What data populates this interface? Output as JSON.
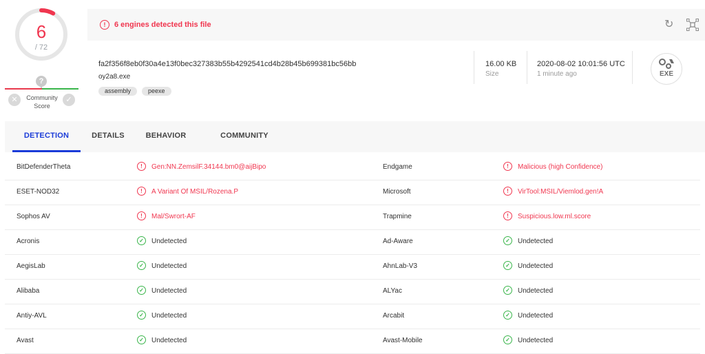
{
  "score": {
    "detected": "6",
    "total": "/ 72"
  },
  "community": {
    "label_line1": "Community",
    "label_line2": "Score",
    "question": "?"
  },
  "banner": {
    "text": "6 engines detected this file"
  },
  "file": {
    "hash": "fa2f356f8eb0f30a4e13f0bec327383b55b4292541cd4b28b45b699381bc56bb",
    "name": "oy2a8.exe",
    "tags": [
      "assembly",
      "peexe"
    ],
    "size_value": "16.00 KB",
    "size_label": "Size",
    "date_value": "2020-08-02 10:01:56 UTC",
    "date_label": "1 minute ago",
    "type_icon_label": "EXE"
  },
  "tabs": [
    {
      "label": "DETECTION",
      "active": true
    },
    {
      "label": "DETAILS",
      "active": false
    },
    {
      "label": "BEHAVIOR",
      "active": false
    },
    {
      "label": "COMMUNITY",
      "active": false
    }
  ],
  "colors": {
    "malicious": "#f0364f",
    "clean": "#39b54a",
    "accent": "#1a3bd8"
  },
  "detections": [
    {
      "left_engine": "BitDefenderTheta",
      "left_result": "Gen:NN.ZemsilF.34144.bm0@aijBipo",
      "left_status": "malicious",
      "right_engine": "Endgame",
      "right_result": "Malicious (high Confidence)",
      "right_status": "malicious"
    },
    {
      "left_engine": "ESET-NOD32",
      "left_result": "A Variant Of MSIL/Rozena.P",
      "left_status": "malicious",
      "right_engine": "Microsoft",
      "right_result": "VirTool:MSIL/Viemlod.gen!A",
      "right_status": "malicious"
    },
    {
      "left_engine": "Sophos AV",
      "left_result": "Mal/Swrort-AF",
      "left_status": "malicious",
      "right_engine": "Trapmine",
      "right_result": "Suspicious.low.ml.score",
      "right_status": "malicious"
    },
    {
      "left_engine": "Acronis",
      "left_result": "Undetected",
      "left_status": "clean",
      "right_engine": "Ad-Aware",
      "right_result": "Undetected",
      "right_status": "clean"
    },
    {
      "left_engine": "AegisLab",
      "left_result": "Undetected",
      "left_status": "clean",
      "right_engine": "AhnLab-V3",
      "right_result": "Undetected",
      "right_status": "clean"
    },
    {
      "left_engine": "Alibaba",
      "left_result": "Undetected",
      "left_status": "clean",
      "right_engine": "ALYac",
      "right_result": "Undetected",
      "right_status": "clean"
    },
    {
      "left_engine": "Antiy-AVL",
      "left_result": "Undetected",
      "left_status": "clean",
      "right_engine": "Arcabit",
      "right_result": "Undetected",
      "right_status": "clean"
    },
    {
      "left_engine": "Avast",
      "left_result": "Undetected",
      "left_status": "clean",
      "right_engine": "Avast-Mobile",
      "right_result": "Undetected",
      "right_status": "clean"
    }
  ]
}
